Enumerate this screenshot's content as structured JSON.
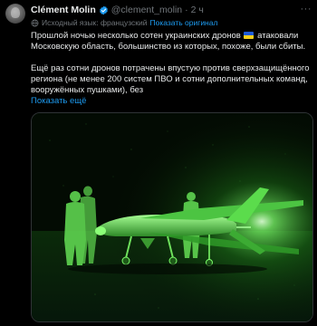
{
  "author": {
    "name": "Clément Molin",
    "handle": "@clement_molin",
    "separator": "·",
    "time": "2 ч"
  },
  "translation": {
    "source_label": "Исходный язык: французский",
    "show_original": "Показать оригинал"
  },
  "post": {
    "line1_before_flag": "Прошлой ночью несколько сотен украинских дронов",
    "flag_icon": "ukraine-flag",
    "line1_after_flag": "атаковали Московскую область, большинство из которых, похоже, были сбиты.",
    "paragraph2": "Ещё раз сотни дронов потрачены впустую против сверхзащищённого региона (не менее 200 систем ПВО и сотни дополнительных команд, вооружённых пушками), без",
    "show_more": "Показать ещё"
  },
  "colors": {
    "background": "#000000",
    "text": "#e7e9ea",
    "muted": "#71767b",
    "link": "#1d9bf0",
    "night_vision": "#7cff6a"
  },
  "media": {
    "description_icon": "night-vision-drone-photo"
  }
}
